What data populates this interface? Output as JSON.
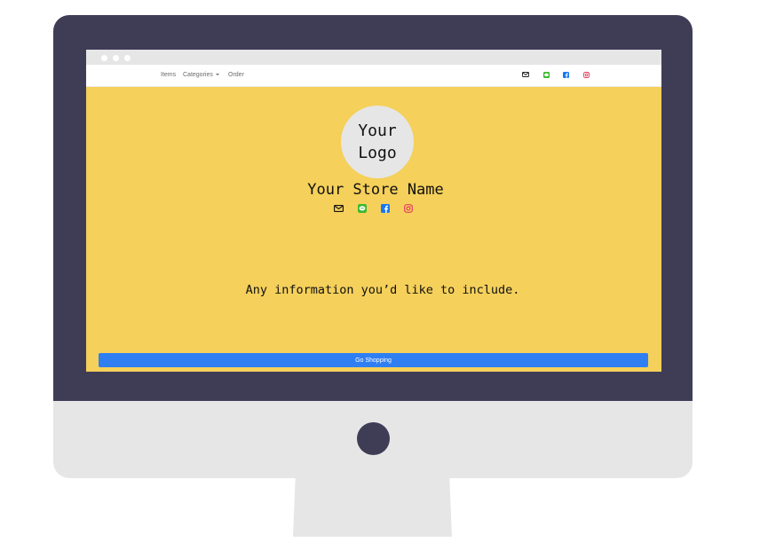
{
  "browser": {
    "window_controls": [
      "window-dot-1",
      "window-dot-2",
      "window-dot-3"
    ]
  },
  "navbar": {
    "items_label": "Items",
    "categories_label": "Categories",
    "order_label": "Order",
    "icons": [
      "mail-icon",
      "line-chat-icon",
      "facebook-icon",
      "instagram-icon"
    ]
  },
  "hero": {
    "logo_line1": "Your",
    "logo_line2": "Logo",
    "store_name": "Your Store Name",
    "social_icons": [
      "mail-icon",
      "line-chat-icon",
      "facebook-icon",
      "instagram-icon"
    ],
    "info_text": "Any information you’d like to include.",
    "shop_button_label": "Go Shopping"
  },
  "colors": {
    "monitor_bezel": "#3f3d56",
    "monitor_body": "#e6e6e6",
    "page_background": "#f5d05a",
    "button_blue": "#2f7ff3",
    "line_green": "#3cb82e",
    "facebook_blue": "#1877f2",
    "instagram_pink": "#e4405f"
  }
}
